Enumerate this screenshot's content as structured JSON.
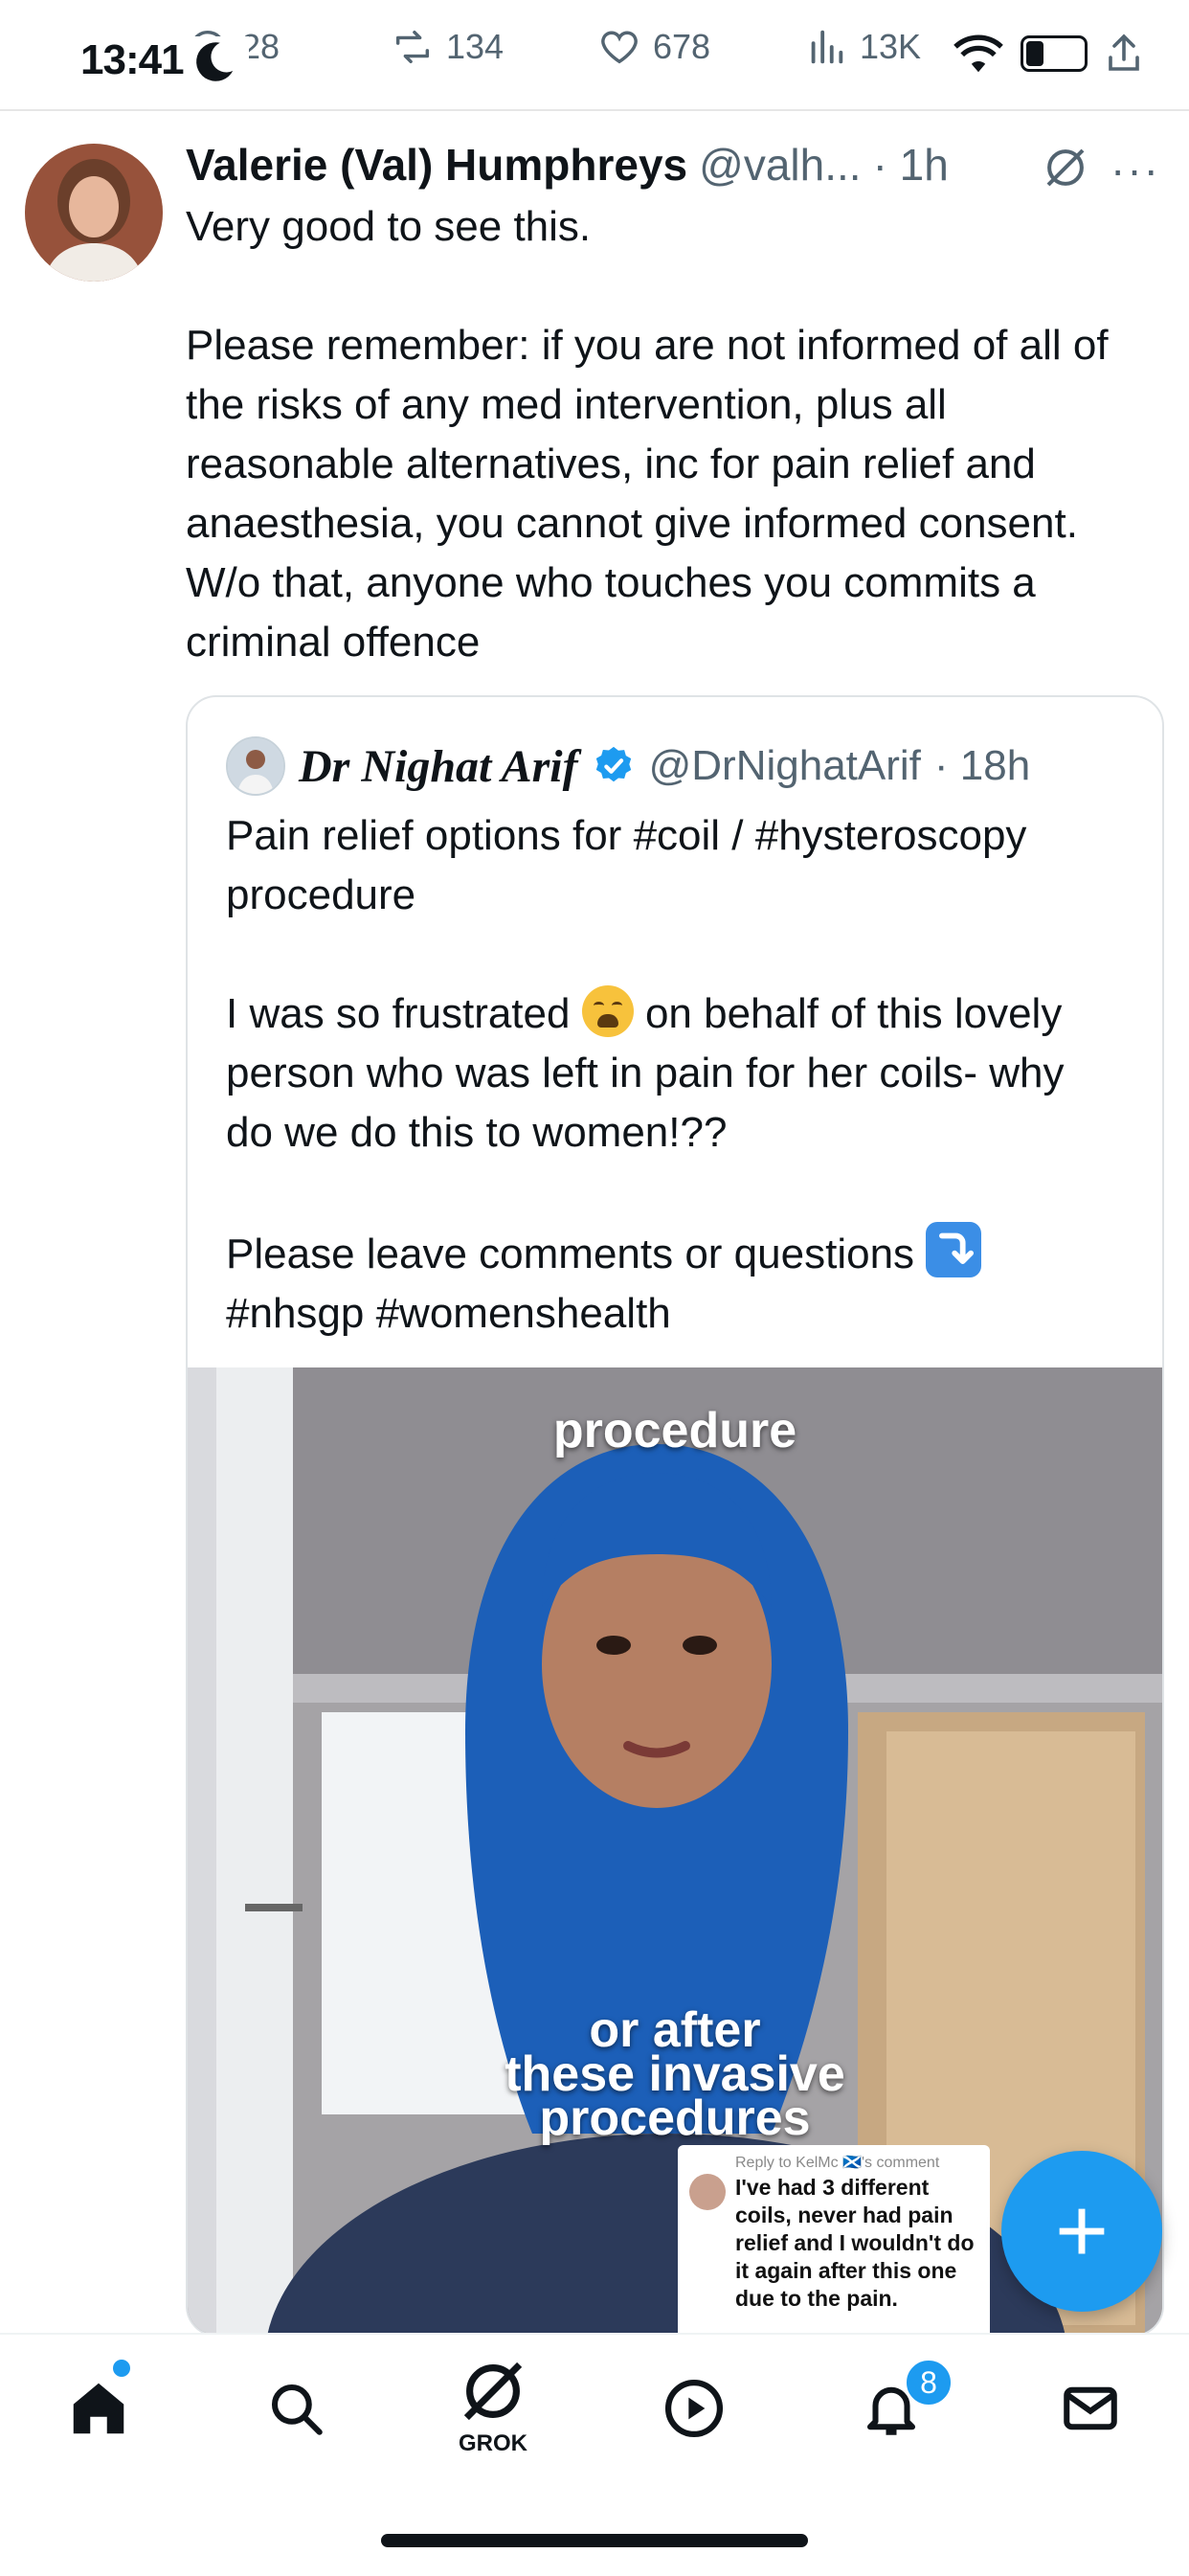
{
  "status_bar": {
    "time": "13:41"
  },
  "engagement": {
    "replies": "28",
    "reposts": "134",
    "likes": "678",
    "views": "13K"
  },
  "post": {
    "author_name": "Valerie (Val) Humphreys",
    "author_handle": "@valh...",
    "time": "· 1h",
    "body": "Very good to see this.\n\nPlease remember: if you are not informed of all of the risks of any med intervention, plus all reasonable alternatives, inc for pain relief and anaesthesia, you cannot give informed consent. W/o that, anyone who touches you commits a criminal offence"
  },
  "quote": {
    "author_name": "Dr Nighat Arif",
    "author_handle": "@DrNighatArif",
    "time": "· 18h",
    "line1": "Pain relief options for #coil / #hysteroscopy procedure",
    "line2a": "I was so frustrated",
    "line2b": "on behalf of this lovely person who was left in pain for her coils- why do we do this to women!??",
    "line3a": "Please leave comments or questions",
    "line3b": "#nhsgp #womenshealth",
    "media": {
      "caption_top": "procedure",
      "caption_bottom_1": "or after",
      "caption_bottom_2": "these invasive",
      "caption_bottom_3": "procedures",
      "reply_card_header": "Reply to KelMc 🏴󠁧󠁢󠁳󠁣󠁴󠁿's comment",
      "reply_card_text": "I've had 3 different coils, never had pain relief and I wouldn't do it again after this one due to the pain."
    }
  },
  "fab": {
    "label": "+"
  },
  "nav": {
    "grok_label": "GROK",
    "notifications_badge": "8"
  },
  "colors": {
    "accent": "#1d9bf0",
    "text": "#0f1419",
    "secondary": "#536471",
    "hijab": "#1c5fb8"
  }
}
